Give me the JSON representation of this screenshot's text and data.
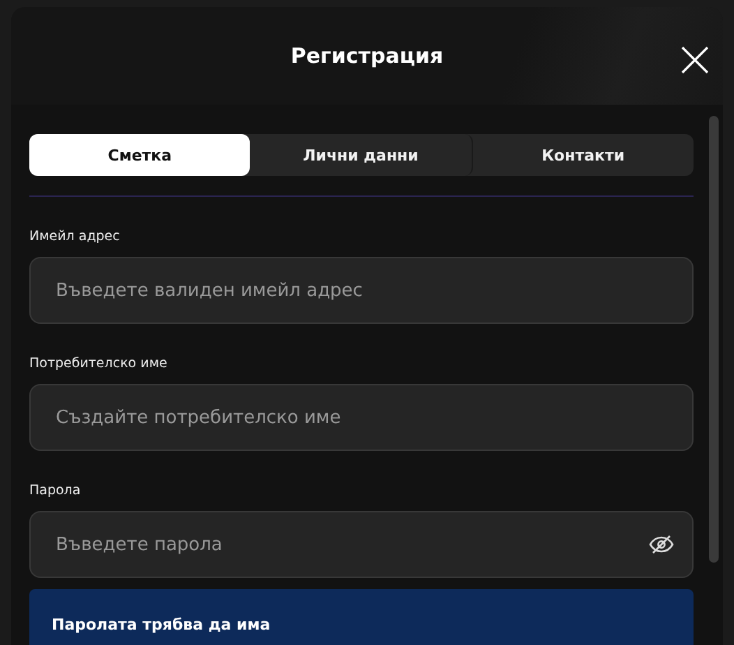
{
  "dialog": {
    "title": "Регистрация"
  },
  "tabs": [
    {
      "label": "Сметка",
      "selected": true
    },
    {
      "label": "Лични данни",
      "selected": false
    },
    {
      "label": "Контакти",
      "selected": false
    }
  ],
  "fields": [
    {
      "label": "Имейл адрес",
      "placeholder": "Въведете валиден имейл адрес",
      "kind": "text"
    },
    {
      "label": "Потребителско име",
      "placeholder": "Създайте потребителско име",
      "kind": "text"
    },
    {
      "label": "Парола",
      "placeholder": "Въведете парола",
      "kind": "password"
    }
  ],
  "notice": {
    "title": "Паролата трябва да има"
  }
}
